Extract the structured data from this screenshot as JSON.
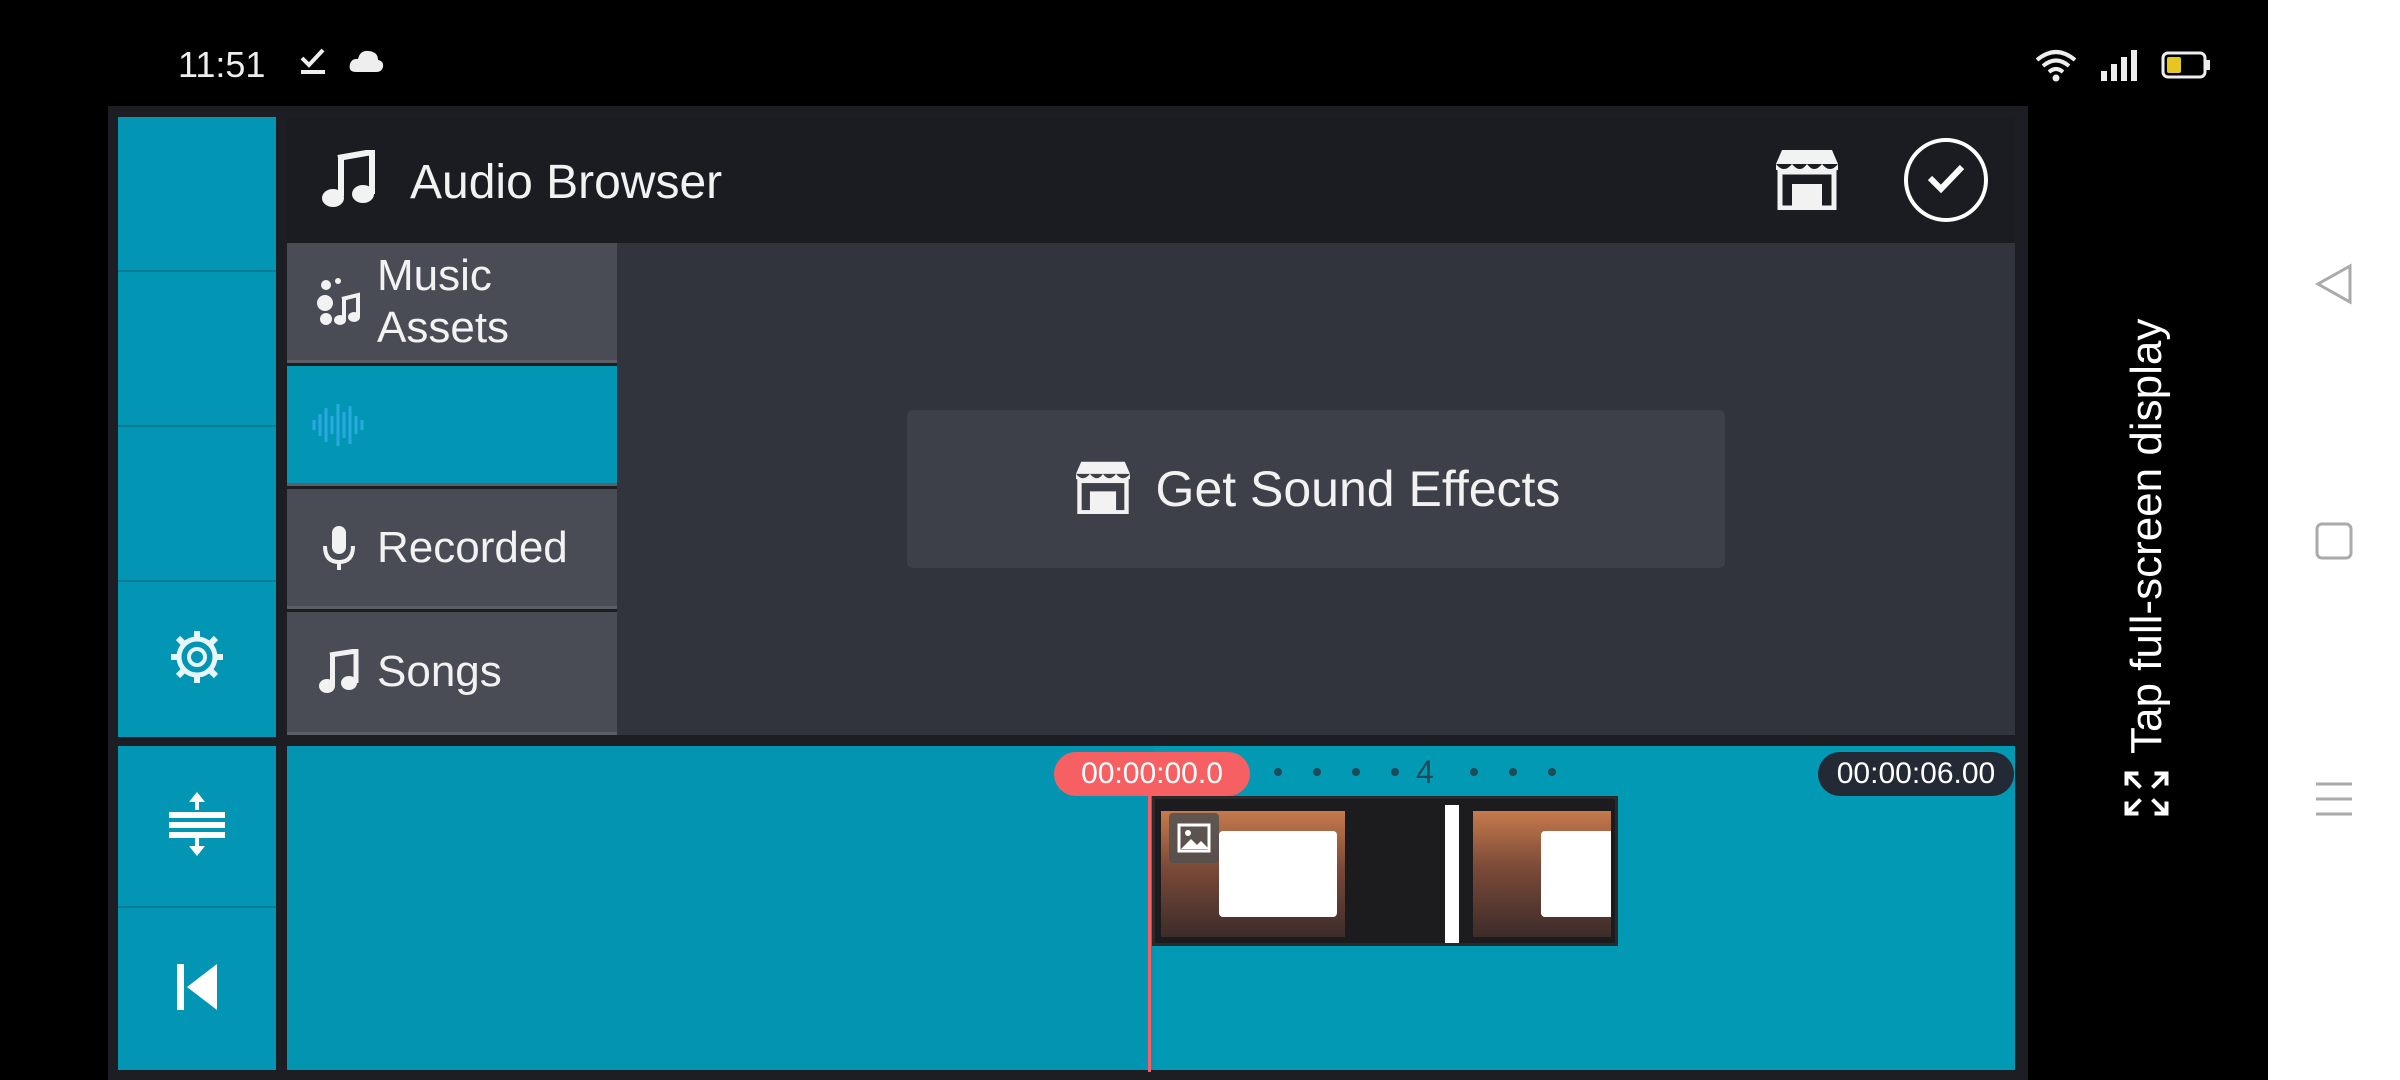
{
  "status_bar": {
    "time": "11:51",
    "left_icons": [
      "check-download-icon",
      "cloud-icon"
    ],
    "right_icons": [
      "wifi-icon",
      "signal-icon",
      "battery-icon"
    ]
  },
  "browser": {
    "title": "Audio Browser",
    "header_icon": "music-note-icon",
    "store_icon": "store-icon",
    "confirm_icon": "checkmark-circle-icon"
  },
  "categories": [
    {
      "label": "Music Assets",
      "icon": "music-assets-icon"
    },
    {
      "label": "",
      "icon": "waveform-icon",
      "selected": true
    },
    {
      "label": "Recorded",
      "icon": "microphone-icon"
    },
    {
      "label": "Songs",
      "icon": "music-note-icon"
    }
  ],
  "content": {
    "get_sound_effects_label": "Get Sound Effects"
  },
  "timeline": {
    "current_time": "00:00:00.0",
    "total_time": "00:00:06.00",
    "marker_number": "4"
  },
  "fullscreen_hint": "Tap full-screen display",
  "colors": {
    "accent": "#0299b5",
    "playhead": "#f66063",
    "panel": "#31333d"
  }
}
